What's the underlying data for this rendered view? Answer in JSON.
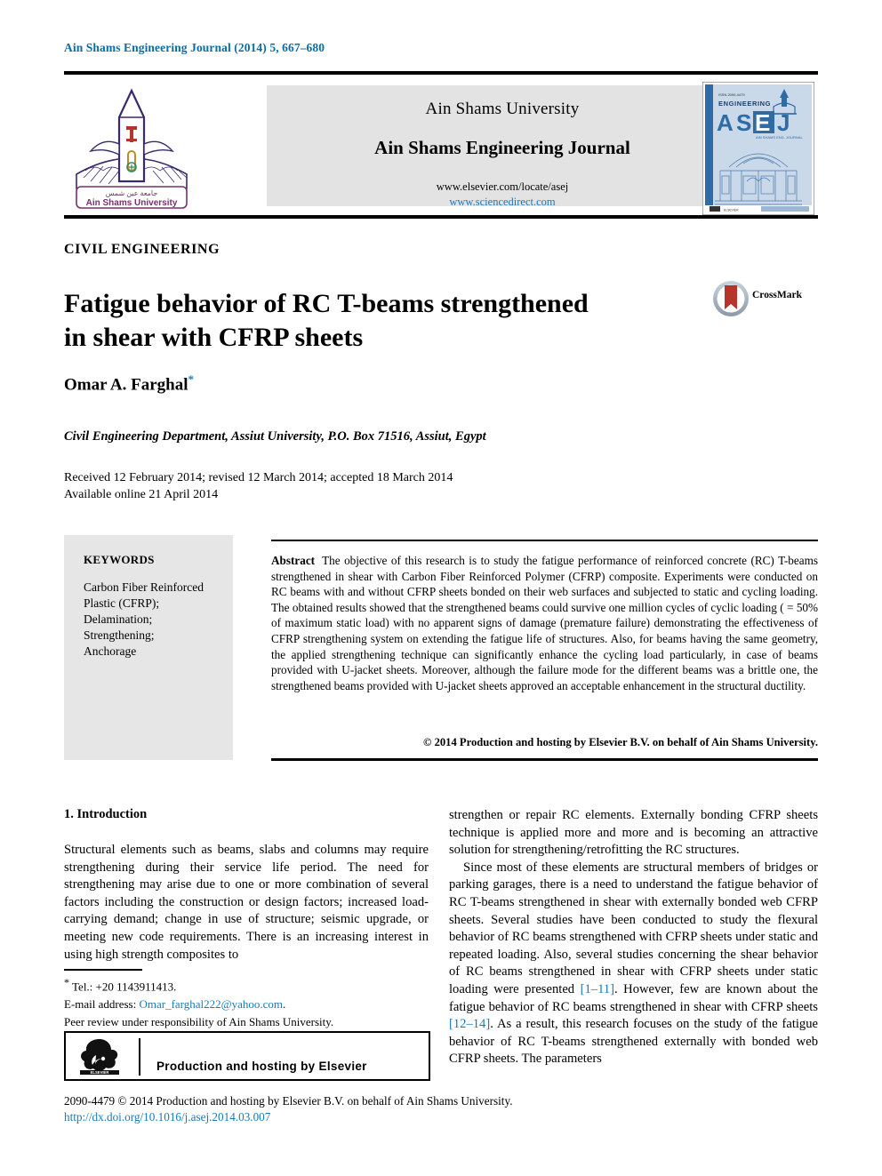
{
  "running_head": "Ain Shams Engineering Journal (2014) 5, 667–680",
  "banner": {
    "university": "Ain Shams University",
    "journal": "Ain Shams Engineering Journal",
    "url_elsevier": "www.elsevier.com/locate/asej",
    "url_sciencedirect": "www.sciencedirect.com",
    "logo_caption_en": "Ain Shams University",
    "cover": {
      "top_small": "ISSN 2090-4479",
      "top_word": "ENGINEERING",
      "acronym": "ASEJ",
      "sub": "AIN SHAMS ENGINEERING JOURNAL"
    }
  },
  "article": {
    "type": "CIVIL ENGINEERING",
    "title_line1": "Fatigue behavior of RC T-beams strengthened",
    "title_line2": "in shear with CFRP sheets",
    "crossmark_label": "CrossMark",
    "author": "Omar A. Farghal",
    "author_marker": "*",
    "affiliation": "Civil Engineering Department, Assiut University, P.O. Box 71516, Assiut, Egypt",
    "dates_line1": "Received 12 February 2014; revised 12 March 2014; accepted 18 March 2014",
    "dates_line2": "Available online 21 April 2014"
  },
  "keywords": {
    "title": "KEYWORDS",
    "text": "Carbon Fiber Reinforced Plastic (CFRP); Delamination; Strengthening; Anchorage",
    "items": [
      "Carbon Fiber Reinforced",
      "Plastic (CFRP);",
      "Delamination;",
      "Strengthening;",
      "Anchorage"
    ]
  },
  "abstract": {
    "label": "Abstract",
    "body": "The objective of this research is to study the fatigue performance of reinforced concrete (RC) T-beams strengthened in shear with Carbon Fiber Reinforced Polymer (CFRP) composite. Experiments were conducted on RC beams with and without CFRP sheets bonded on their web surfaces and subjected to static and cycling loading. The obtained results showed that the strengthened beams could survive one million cycles of cyclic loading ( = 50% of maximum static load) with no apparent signs of damage (premature failure) demonstrating the effectiveness of CFRP strengthening system on extending the fatigue life of structures. Also, for beams having the same geometry, the applied strengthening technique can significantly enhance the cycling load particularly, in case of beams provided with U-jacket sheets. Moreover, although the failure mode for the different beams was a brittle one, the strengthened beams provided with U-jacket sheets approved an acceptable enhancement in the structural ductility.",
    "copyright": "© 2014 Production and hosting by Elsevier B.V. on behalf of Ain Shams University."
  },
  "body": {
    "section_heading": "1. Introduction",
    "left_paragraph": "Structural elements such as beams, slabs and columns may require strengthening during their service life period. The need for strengthening may arise due to one or more combination of several factors including the construction or design factors; increased load-carrying demand; change in use of structure; seismic upgrade, or meeting new code requirements. There is an increasing interest in using high strength composites to",
    "right_paragraph_1": "strengthen or repair RC elements. Externally bonding CFRP sheets technique is applied more and more and is becoming an attractive solution for strengthening/retrofitting the RC structures.",
    "right_paragraph_2_a": "Since most of these elements are structural members of bridges or parking garages, there is a need to understand the fatigue behavior of RC T-beams strengthened in shear with externally bonded web CFRP sheets. Several studies have been conducted to study the flexural behavior of RC beams strengthened with CFRP sheets under static and repeated loading. Also, several studies concerning the shear behavior of RC beams strengthened in shear with CFRP sheets under static loading were presented ",
    "citation_1": "[1–11]",
    "right_paragraph_2_b": ". However, few are known about the fatigue behavior of RC beams strengthened in shear with CFRP sheets ",
    "citation_2": "[12–14]",
    "right_paragraph_2_c": ". As a result, this research focuses on the study of the fatigue behavior of RC T-beams strengthened externally with bonded web CFRP sheets. The parameters"
  },
  "footnotes": {
    "tel": "Tel.: +20 1143911413.",
    "tel_marker": "*",
    "email_label": "E-mail address:",
    "email": "Omar_farghal222@yahoo.com",
    "peer_review": "Peer review under responsibility of Ain Shams University."
  },
  "elsevier_box": {
    "text": "Production and hosting by Elsevier",
    "logo_word": "ELSEVIER"
  },
  "footer": {
    "copyright": "2090-4479 © 2014 Production and hosting by Elsevier B.V. on behalf of Ain Shams University.",
    "doi": "http://dx.doi.org/10.1016/j.asej.2014.03.007"
  },
  "colors": {
    "link": "#1b7ab5",
    "running_head": "#0a6ea4",
    "panel_gray": "#e6e6e6",
    "banner_gray": "#e3e3e3",
    "cover_blue": "#4a79ad",
    "crossmark_red": "#b5342b"
  }
}
